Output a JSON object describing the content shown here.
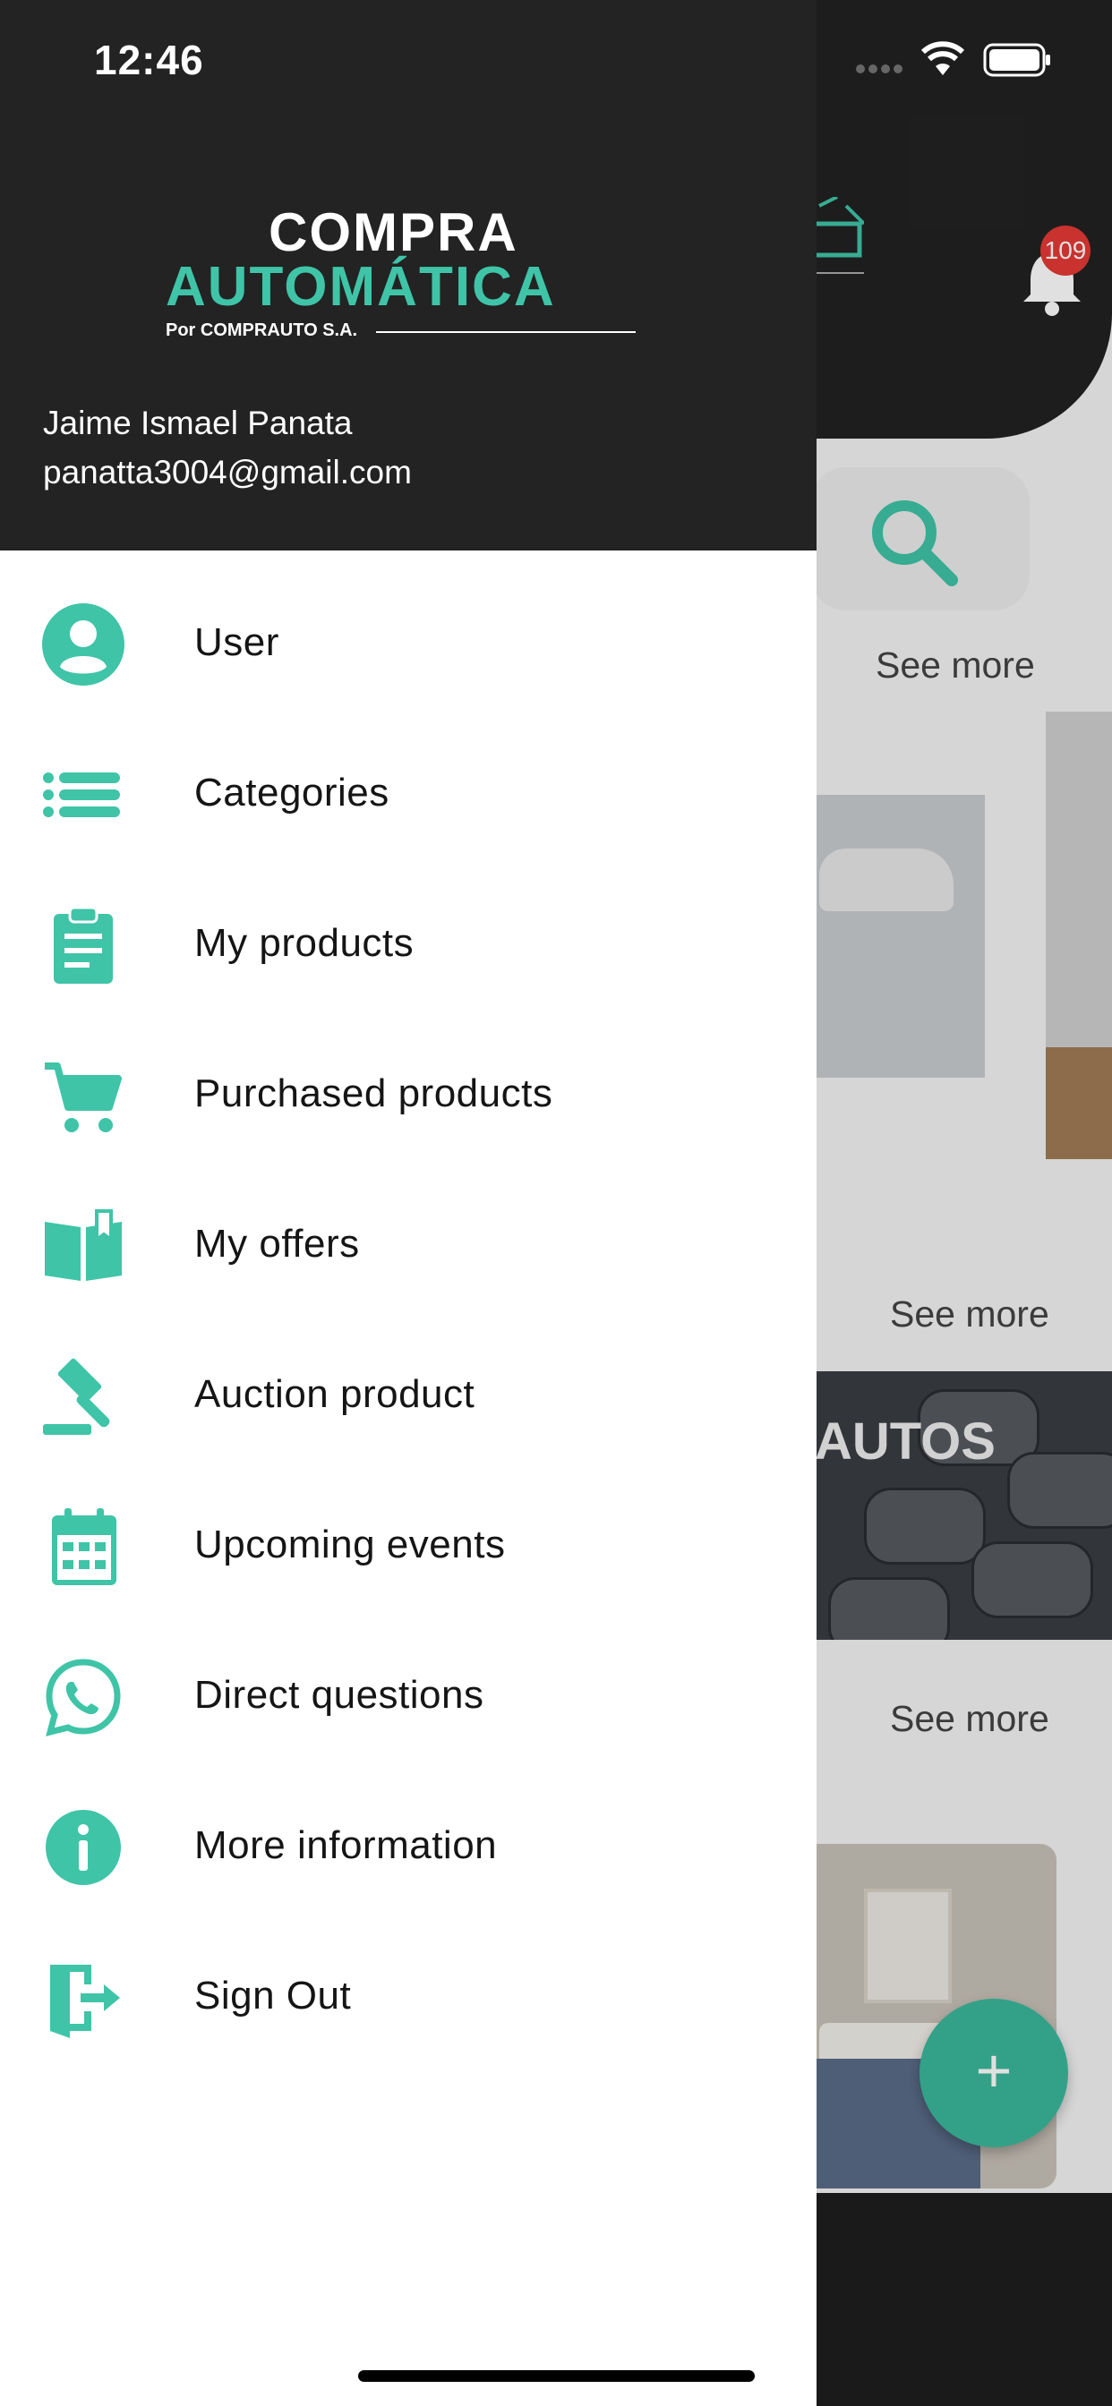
{
  "status_bar": {
    "time": "12:46"
  },
  "brand": {
    "line1": "COMPRA",
    "line2": "AUTOMÁTICA",
    "tagline": "Por COMPRAUTO S.A.",
    "accent": "#3fc4a7"
  },
  "user": {
    "name": "Jaime Ismael Panata",
    "email": "panatta3004@gmail.com"
  },
  "menu": {
    "items": [
      {
        "label": "User",
        "icon": "user-circle-icon"
      },
      {
        "label": "Categories",
        "icon": "list-icon"
      },
      {
        "label": "My products",
        "icon": "clipboard-icon"
      },
      {
        "label": "Purchased products",
        "icon": "cart-icon"
      },
      {
        "label": "My offers",
        "icon": "book-open-icon"
      },
      {
        "label": "Auction product",
        "icon": "gavel-icon"
      },
      {
        "label": "Upcoming events",
        "icon": "calendar-icon"
      },
      {
        "label": "Direct questions",
        "icon": "whatsapp-icon"
      },
      {
        "label": "More information",
        "icon": "info-icon"
      },
      {
        "label": "Sign Out",
        "icon": "sign-out-icon"
      }
    ]
  },
  "background": {
    "notification_count": "109",
    "see_more": "See more",
    "banner_text": "AUTOS",
    "fab_symbol": "+"
  }
}
